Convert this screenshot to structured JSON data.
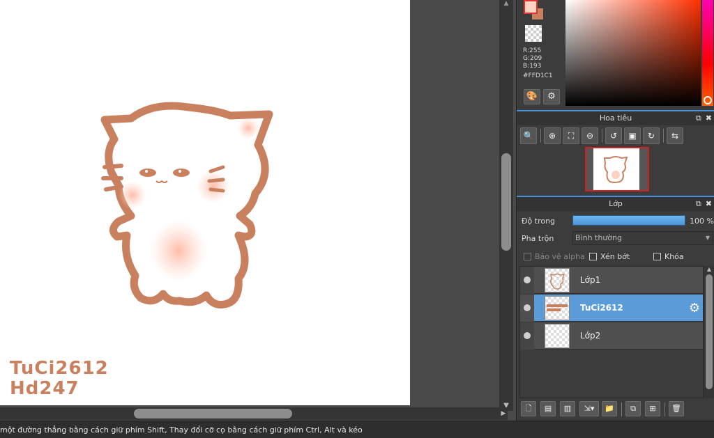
{
  "canvas": {
    "signature_line1": "TuCi2612",
    "signature_line2": "Hd247"
  },
  "status_bar": {
    "text": "một đường thẳng bằng cách giữ phím Shift, Thay đổi cỡ cọ bằng cách giữ phím Ctrl, Alt và kéo"
  },
  "color": {
    "foreground": "#FFD1C1",
    "background": "#C9805E",
    "r_label": "R:255",
    "g_label": "G:209",
    "b_label": "B:193",
    "hex_label": "#FFD1C1"
  },
  "navigator": {
    "title": "Hoa tiêu",
    "tools": [
      "zoom-fit-icon",
      "zoom-in-icon",
      "fit-window-icon",
      "zoom-out-icon",
      "rotate-left-icon",
      "actual-size-icon",
      "rotate-right-icon",
      "flip-icon"
    ]
  },
  "layers_panel": {
    "title": "Lớp",
    "opacity_label": "Độ trong",
    "opacity_value": "100 %",
    "blend_label": "Pha trộn",
    "blend_value": "Bình thường",
    "protect_alpha_label": "Bảo vệ alpha",
    "clipping_label": "Xén bớt",
    "lock_label": "Khóa",
    "layers": [
      {
        "name": "Lớp1",
        "active": false
      },
      {
        "name": "TuCi2612",
        "active": true
      },
      {
        "name": "Lớp2",
        "active": false
      }
    ]
  },
  "accent_color": "#5B9BD8"
}
